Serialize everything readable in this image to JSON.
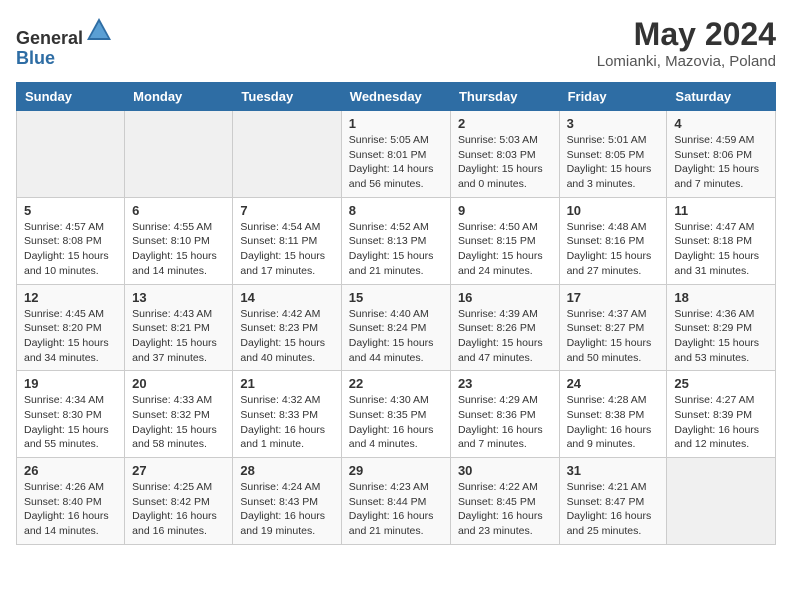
{
  "header": {
    "logo_general": "General",
    "logo_blue": "Blue",
    "title": "May 2024",
    "subtitle": "Lomianki, Mazovia, Poland"
  },
  "days_of_week": [
    "Sunday",
    "Monday",
    "Tuesday",
    "Wednesday",
    "Thursday",
    "Friday",
    "Saturday"
  ],
  "weeks": [
    {
      "cells": [
        {
          "day": "",
          "content": ""
        },
        {
          "day": "",
          "content": ""
        },
        {
          "day": "",
          "content": ""
        },
        {
          "day": "1",
          "content": "Sunrise: 5:05 AM\nSunset: 8:01 PM\nDaylight: 14 hours\nand 56 minutes."
        },
        {
          "day": "2",
          "content": "Sunrise: 5:03 AM\nSunset: 8:03 PM\nDaylight: 15 hours\nand 0 minutes."
        },
        {
          "day": "3",
          "content": "Sunrise: 5:01 AM\nSunset: 8:05 PM\nDaylight: 15 hours\nand 3 minutes."
        },
        {
          "day": "4",
          "content": "Sunrise: 4:59 AM\nSunset: 8:06 PM\nDaylight: 15 hours\nand 7 minutes."
        }
      ]
    },
    {
      "cells": [
        {
          "day": "5",
          "content": "Sunrise: 4:57 AM\nSunset: 8:08 PM\nDaylight: 15 hours\nand 10 minutes."
        },
        {
          "day": "6",
          "content": "Sunrise: 4:55 AM\nSunset: 8:10 PM\nDaylight: 15 hours\nand 14 minutes."
        },
        {
          "day": "7",
          "content": "Sunrise: 4:54 AM\nSunset: 8:11 PM\nDaylight: 15 hours\nand 17 minutes."
        },
        {
          "day": "8",
          "content": "Sunrise: 4:52 AM\nSunset: 8:13 PM\nDaylight: 15 hours\nand 21 minutes."
        },
        {
          "day": "9",
          "content": "Sunrise: 4:50 AM\nSunset: 8:15 PM\nDaylight: 15 hours\nand 24 minutes."
        },
        {
          "day": "10",
          "content": "Sunrise: 4:48 AM\nSunset: 8:16 PM\nDaylight: 15 hours\nand 27 minutes."
        },
        {
          "day": "11",
          "content": "Sunrise: 4:47 AM\nSunset: 8:18 PM\nDaylight: 15 hours\nand 31 minutes."
        }
      ]
    },
    {
      "cells": [
        {
          "day": "12",
          "content": "Sunrise: 4:45 AM\nSunset: 8:20 PM\nDaylight: 15 hours\nand 34 minutes."
        },
        {
          "day": "13",
          "content": "Sunrise: 4:43 AM\nSunset: 8:21 PM\nDaylight: 15 hours\nand 37 minutes."
        },
        {
          "day": "14",
          "content": "Sunrise: 4:42 AM\nSunset: 8:23 PM\nDaylight: 15 hours\nand 40 minutes."
        },
        {
          "day": "15",
          "content": "Sunrise: 4:40 AM\nSunset: 8:24 PM\nDaylight: 15 hours\nand 44 minutes."
        },
        {
          "day": "16",
          "content": "Sunrise: 4:39 AM\nSunset: 8:26 PM\nDaylight: 15 hours\nand 47 minutes."
        },
        {
          "day": "17",
          "content": "Sunrise: 4:37 AM\nSunset: 8:27 PM\nDaylight: 15 hours\nand 50 minutes."
        },
        {
          "day": "18",
          "content": "Sunrise: 4:36 AM\nSunset: 8:29 PM\nDaylight: 15 hours\nand 53 minutes."
        }
      ]
    },
    {
      "cells": [
        {
          "day": "19",
          "content": "Sunrise: 4:34 AM\nSunset: 8:30 PM\nDaylight: 15 hours\nand 55 minutes."
        },
        {
          "day": "20",
          "content": "Sunrise: 4:33 AM\nSunset: 8:32 PM\nDaylight: 15 hours\nand 58 minutes."
        },
        {
          "day": "21",
          "content": "Sunrise: 4:32 AM\nSunset: 8:33 PM\nDaylight: 16 hours\nand 1 minute."
        },
        {
          "day": "22",
          "content": "Sunrise: 4:30 AM\nSunset: 8:35 PM\nDaylight: 16 hours\nand 4 minutes."
        },
        {
          "day": "23",
          "content": "Sunrise: 4:29 AM\nSunset: 8:36 PM\nDaylight: 16 hours\nand 7 minutes."
        },
        {
          "day": "24",
          "content": "Sunrise: 4:28 AM\nSunset: 8:38 PM\nDaylight: 16 hours\nand 9 minutes."
        },
        {
          "day": "25",
          "content": "Sunrise: 4:27 AM\nSunset: 8:39 PM\nDaylight: 16 hours\nand 12 minutes."
        }
      ]
    },
    {
      "cells": [
        {
          "day": "26",
          "content": "Sunrise: 4:26 AM\nSunset: 8:40 PM\nDaylight: 16 hours\nand 14 minutes."
        },
        {
          "day": "27",
          "content": "Sunrise: 4:25 AM\nSunset: 8:42 PM\nDaylight: 16 hours\nand 16 minutes."
        },
        {
          "day": "28",
          "content": "Sunrise: 4:24 AM\nSunset: 8:43 PM\nDaylight: 16 hours\nand 19 minutes."
        },
        {
          "day": "29",
          "content": "Sunrise: 4:23 AM\nSunset: 8:44 PM\nDaylight: 16 hours\nand 21 minutes."
        },
        {
          "day": "30",
          "content": "Sunrise: 4:22 AM\nSunset: 8:45 PM\nDaylight: 16 hours\nand 23 minutes."
        },
        {
          "day": "31",
          "content": "Sunrise: 4:21 AM\nSunset: 8:47 PM\nDaylight: 16 hours\nand 25 minutes."
        },
        {
          "day": "",
          "content": ""
        }
      ]
    }
  ]
}
